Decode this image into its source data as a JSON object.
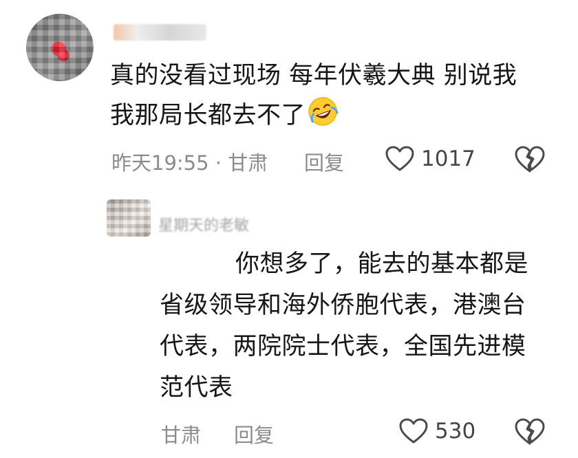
{
  "comment": {
    "author_name": "",
    "text_line1": "真的没看过现场 每年伏羲大典 别说我",
    "text_line2": "我那局长都去不了",
    "emoji": "rolling-on-floor-laughing",
    "time": "昨天19:55",
    "separator": " · ",
    "location": "甘肃",
    "reply_label": "回复",
    "likes": "1017"
  },
  "reply": {
    "author_name": "星期天的老敏",
    "text_line1": "你想多了，能去的基本都是",
    "text_line2": "省级领导和海外侨胞代表，港澳台",
    "text_line3": "代表，两院院士代表，全国先进模",
    "text_line4": "范代表",
    "location": "甘肃",
    "reply_label": "回复",
    "likes": "530"
  },
  "colors": {
    "text": "#161616",
    "meta": "#8b8b8b",
    "icon": "#4a4a4a"
  }
}
